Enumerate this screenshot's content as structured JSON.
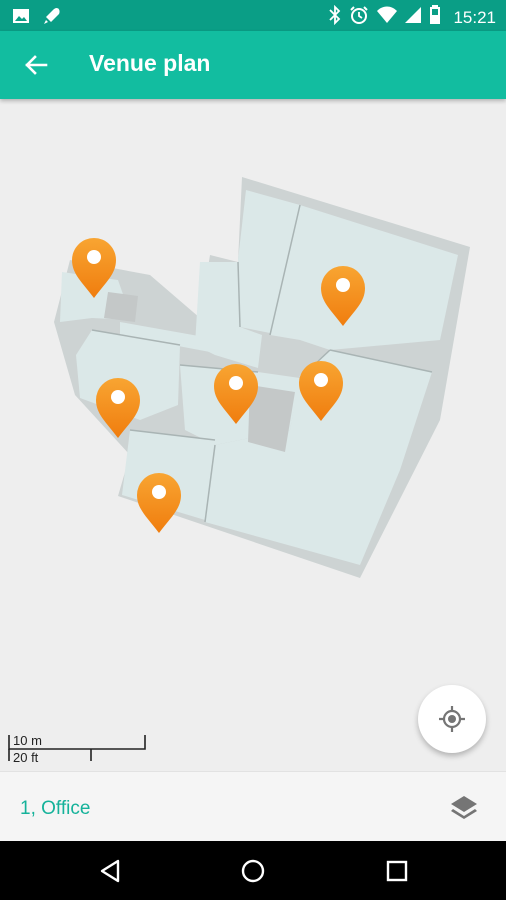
{
  "status_bar": {
    "time": "15:21",
    "left_icons": [
      "image-icon",
      "rocket-icon"
    ],
    "right_icons": [
      "bluetooth-icon",
      "alarm-icon",
      "wifi-icon",
      "signal-icon",
      "battery-icon"
    ]
  },
  "app_bar": {
    "back_icon": "arrow-back-icon",
    "title": "Venue plan"
  },
  "map": {
    "markers_count": 6,
    "marker_color": "#f7931e",
    "floor_fill": "#dbe8e8",
    "wall_color": "#c8cccc"
  },
  "scale_bar": {
    "metric": "10 m",
    "imperial": "20 ft"
  },
  "locate_button": {
    "icon": "my-location-icon"
  },
  "bottom_bar": {
    "level_label": "1, Office",
    "layers_icon": "layers-icon"
  },
  "nav_bar": {
    "icons": [
      "back-triangle-icon",
      "home-circle-icon",
      "recents-square-icon"
    ]
  },
  "colors": {
    "status_bar": "#0a9e86",
    "app_bar": "#12bda0",
    "accent_text": "#15b29a"
  }
}
